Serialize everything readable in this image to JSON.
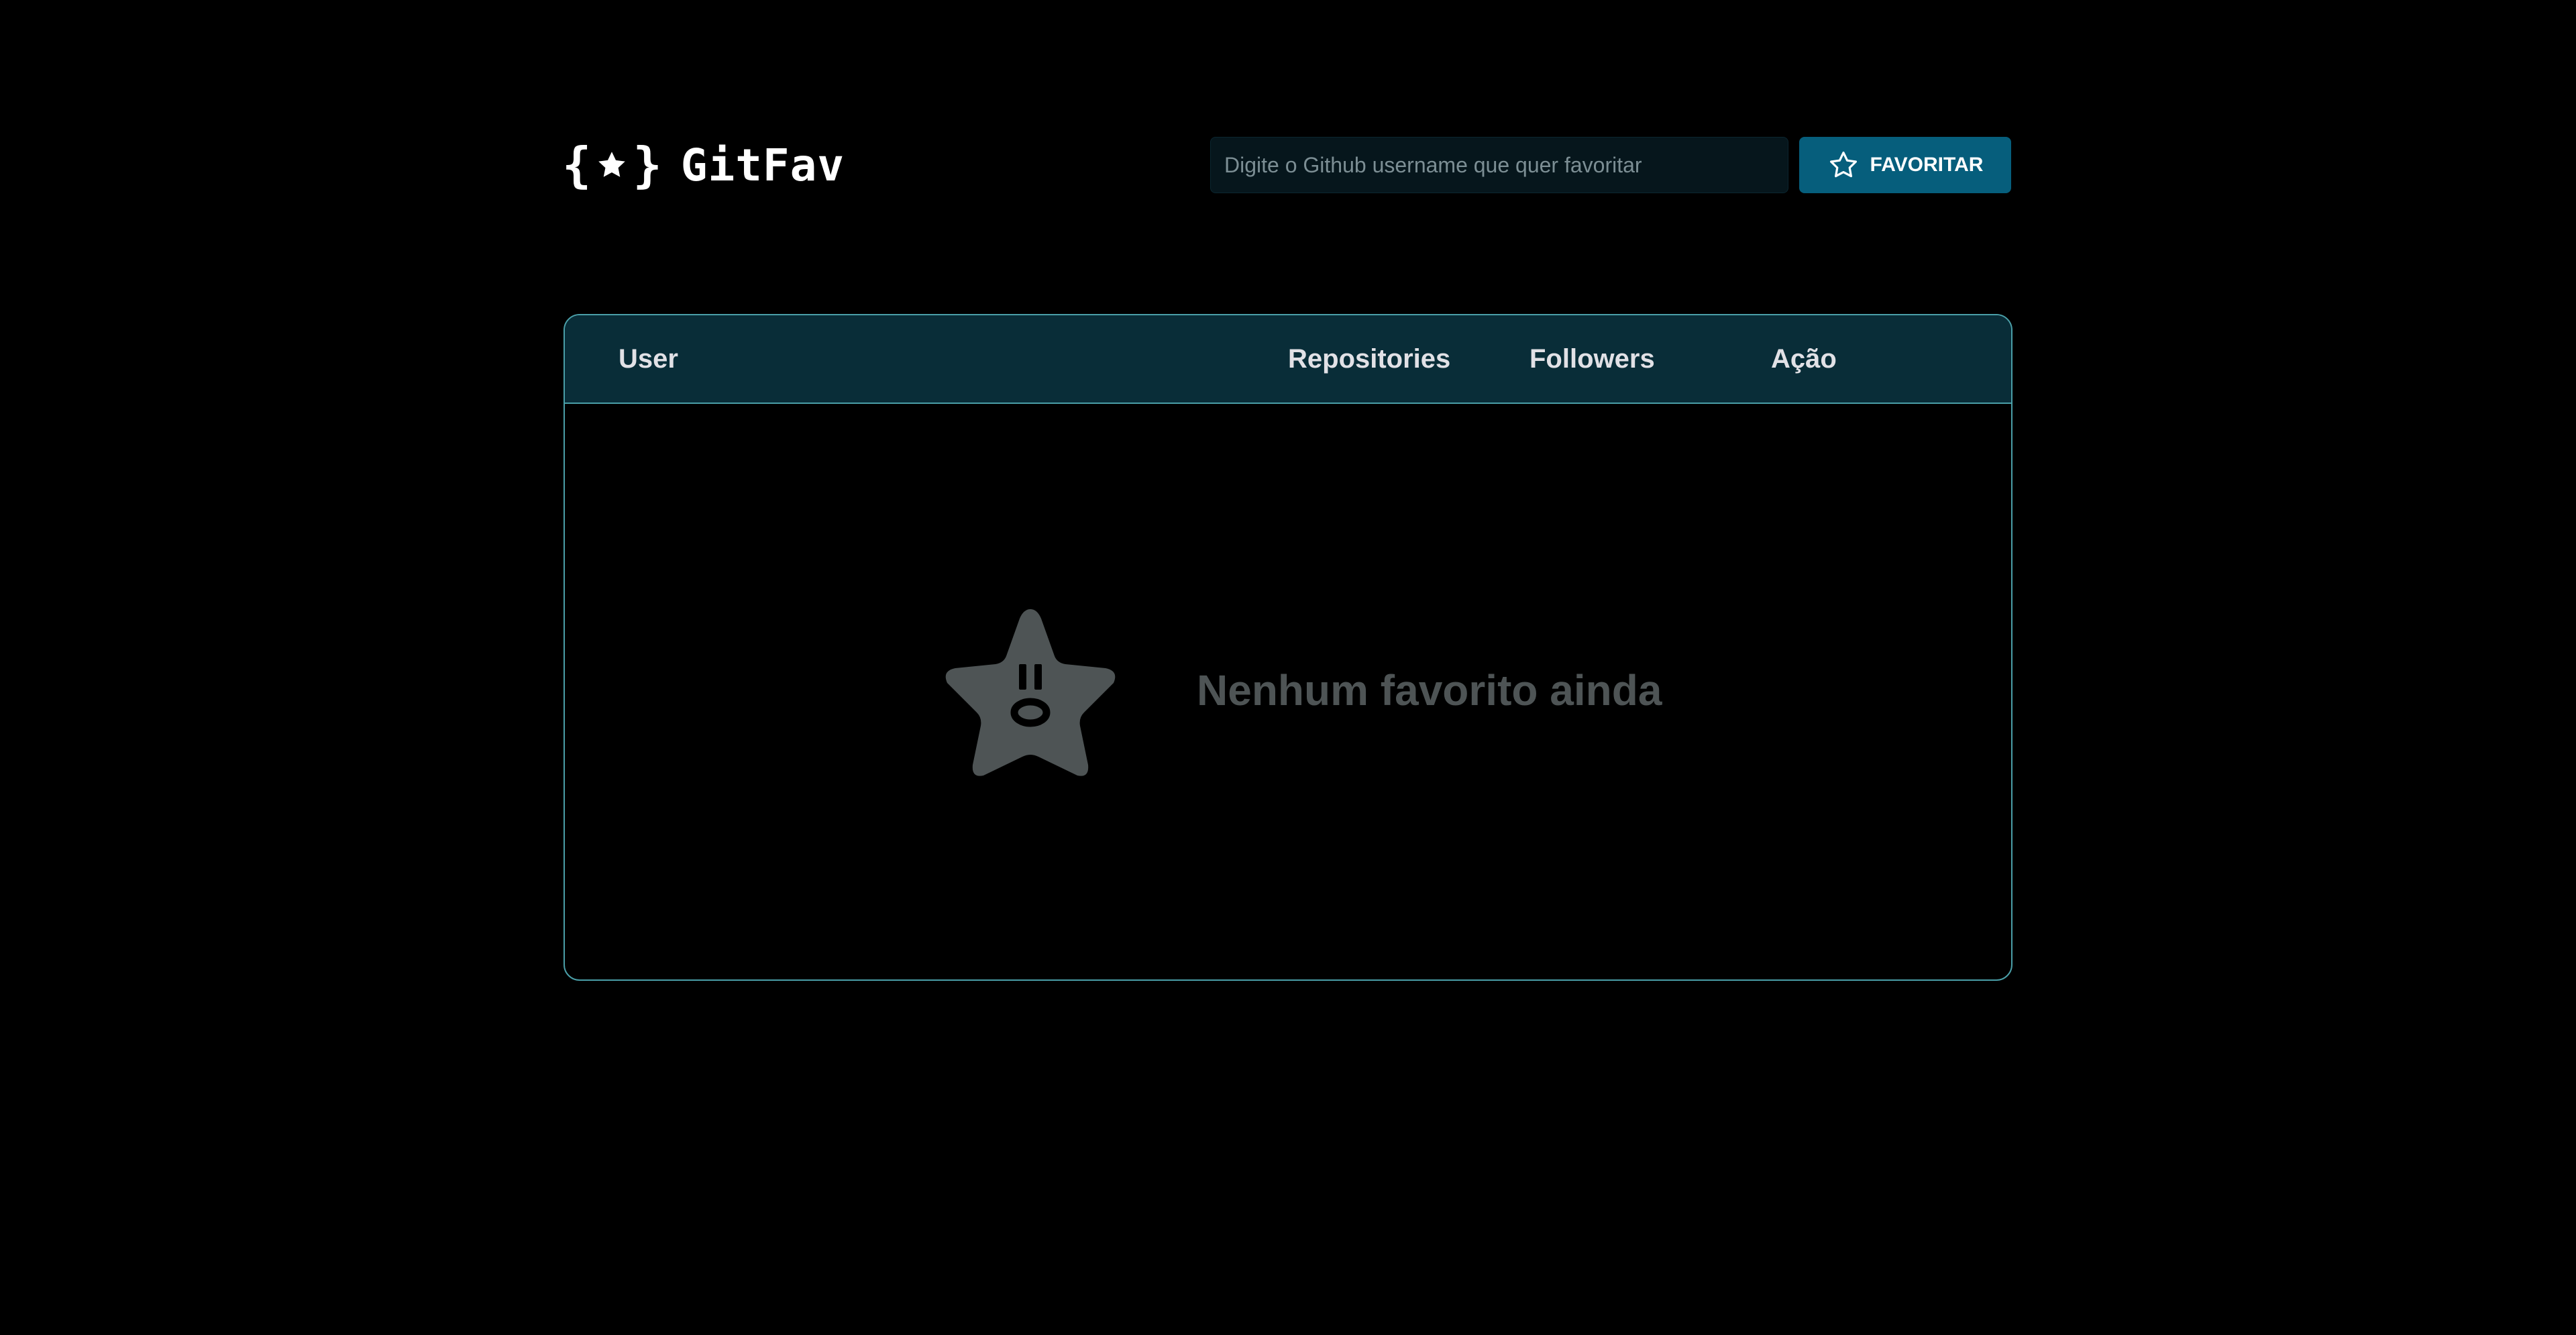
{
  "header": {
    "logo_text": "GitFav",
    "logo_icon": "star-in-braces-icon"
  },
  "search": {
    "placeholder": "Digite o Github username que quer favoritar",
    "value": "",
    "button_label": "FAVORITAR",
    "button_icon": "star-outline-icon"
  },
  "table": {
    "columns": [
      "User",
      "Repositories",
      "Followers",
      "Ação"
    ],
    "rows": []
  },
  "empty_state": {
    "message": "Nenhum favorito ainda",
    "icon": "sad-star-icon"
  },
  "colors": {
    "background": "#000000",
    "table_header_bg": "#092d38",
    "table_border": "#4a9fa8",
    "button_bg": "#065e7c",
    "input_bg": "#06161c",
    "empty_text": "#4e5455",
    "empty_icon": "#4e5455"
  }
}
